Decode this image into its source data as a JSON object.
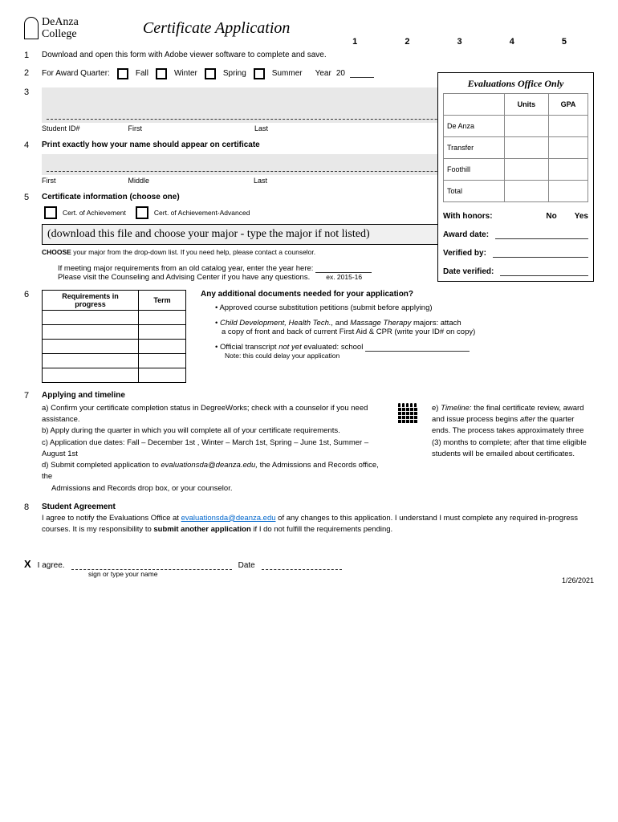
{
  "logo": {
    "line1": "DeAnza",
    "line2": "College"
  },
  "title": "Certificate Application",
  "pagenums": "1    2    3    4    5",
  "s1": {
    "text": "Download and open this form with Adobe viewer software to complete and save."
  },
  "s2": {
    "label": "For Award Quarter:",
    "fall": "Fall",
    "winter": "Winter",
    "spring": "Spring",
    "summer": "Summer",
    "year_label": "Year",
    "year_prefix": "20"
  },
  "s3": {
    "id": "Student ID#",
    "first": "First",
    "last": "Last"
  },
  "s4": {
    "heading": "Print exactly how your name should appear on certificate",
    "first": "First",
    "middle": "Middle",
    "last": "Last"
  },
  "s5": {
    "heading": "Certificate information (choose one)",
    "opt1": "Cert. of Achievement",
    "opt2": "Cert. of Achievement-Advanced",
    "dropdown": "(download this file and choose your major - type the major if not listed)",
    "choose": "CHOOSE your major from the drop-down list.  If you need help, please contact a counselor.",
    "catalog1": "If meeting major requirements from an old catalog year, enter the year here:",
    "catalog2": "Please visit the Counseling and Advising Center if you have any questions.",
    "ex": "ex. 2015-16"
  },
  "s6": {
    "col1": "Requirements in progress",
    "col2": "Term",
    "docs_heading": "Any additional documents needed for your application?",
    "d1": "• Approved course substitution petitions (submit before applying)",
    "d2a": "• ",
    "d2_em": "Child Development, Health Tech.,",
    "d2b": " and ",
    "d2_em2": "Massage Therapy",
    "d2c": " majors: attach",
    "d2d": "a copy of front and back of current First Aid & CPR (write your ID# on copy)",
    "d3a": "• Official transcript ",
    "d3_em": "not yet",
    "d3b": " evaluated: school",
    "d3_note": "Note: this could delay your application"
  },
  "s7": {
    "heading": "Applying and timeline",
    "a": "a)  Confirm your certificate completion status in DegreeWorks; check with a counselor if you need assistance.",
    "b": "b)  Apply during the quarter in which you will complete all of your certificate requirements.",
    "c": "c) Application due dates: Fall – December 1st ,  Winter – March 1st,  Spring – June 1st,  Summer – August 1st",
    "d1": "d)  Submit completed application to ",
    "d_em": "evaluationsda@deanza.edu,",
    "d2": " the Admissions and Records office, the",
    "d3": "Admissions and Records drop box, or your counselor.",
    "e1": "e) ",
    "e_em": "Timeline:",
    "e2": " the final certificate review, award and issue process begins ",
    "e_em2": "after",
    "e3": " the quarter ends.  The process takes approximately three (3) months to complete; after that time eligible students will be emailed about certificates."
  },
  "s8": {
    "heading": "Student Agreement",
    "p1a": "I agree to notify the Evaluations Office at ",
    "email": "evaluationsda@deanza.edu",
    "p1b": " of any changes to this application. I understand I must complete any required in-progress courses. It is my responsibility to ",
    "p1c": "submit another application",
    "p1d": " if I do not fulfill the requirements pending."
  },
  "sig": {
    "x": "X",
    "agree": "I agree.",
    "date": "Date",
    "hint": "sign or type your name"
  },
  "footer_date": "1/26/2021",
  "eval": {
    "title": "Evaluations Office Only",
    "units": "Units",
    "gpa": "GPA",
    "deanza": "De Anza",
    "transfer": "Transfer",
    "foothill": "Foothill",
    "total": "Total",
    "honors": "With honors:",
    "no": "No",
    "yes": "Yes",
    "award": "Award date:",
    "verified": "Verified by:",
    "datev": "Date verified:"
  }
}
